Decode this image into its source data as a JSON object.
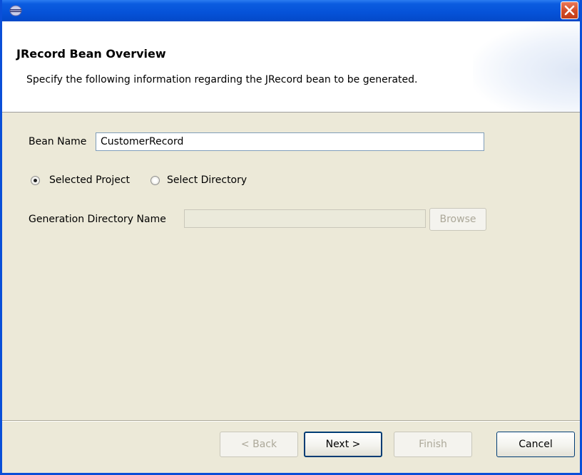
{
  "header": {
    "title": "JRecord Bean Overview",
    "description": "Specify the following information regarding the JRecord bean to be generated."
  },
  "form": {
    "bean_name_label": "Bean Name",
    "bean_name_value": "CustomerRecord",
    "radio_selected_project": "Selected Project",
    "radio_select_directory": "Select Directory",
    "selected_option": "Selected Project",
    "gen_dir_label": "Generation Directory Name",
    "gen_dir_value": "",
    "browse_label": "Browse"
  },
  "footer": {
    "back_label": "< Back",
    "next_label": "Next >",
    "finish_label": "Finish",
    "cancel_label": "Cancel"
  },
  "icons": {
    "app_icon": "eclipse-icon",
    "close_icon": "close-icon"
  },
  "colors": {
    "titlebar": "#0552d8",
    "close_button": "#d14b26",
    "dialog_bg": "#ece9d8"
  }
}
